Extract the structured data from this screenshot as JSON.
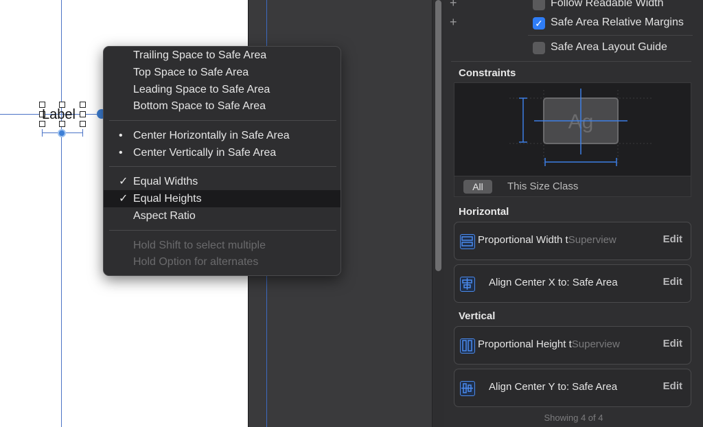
{
  "canvas": {
    "label": "Label"
  },
  "menu": {
    "items": [
      {
        "label": "Trailing Space to Safe Area",
        "mark": ""
      },
      {
        "label": "Top Space to Safe Area",
        "mark": ""
      },
      {
        "label": "Leading Space to Safe Area",
        "mark": ""
      },
      {
        "label": "Bottom Space to Safe Area",
        "mark": ""
      },
      {
        "label": "Center Horizontally in Safe Area",
        "mark": "•"
      },
      {
        "label": "Center Vertically in Safe Area",
        "mark": "•"
      },
      {
        "label": "Equal Widths",
        "mark": "✓"
      },
      {
        "label": "Equal Heights",
        "mark": "✓"
      },
      {
        "label": "Aspect Ratio",
        "mark": ""
      },
      {
        "label": "Hold Shift to select multiple",
        "mark": ""
      },
      {
        "label": "Hold Option for alternates",
        "mark": ""
      }
    ]
  },
  "inspector": {
    "options": [
      {
        "label": "Follow Readable Width",
        "checked": false
      },
      {
        "label": "Safe Area Relative Margins",
        "checked": true
      },
      {
        "label": "Safe Area Layout Guide",
        "checked": false
      }
    ],
    "constraints_title": "Constraints",
    "preview_text": "Ag",
    "size_tabs": {
      "all": "All",
      "this_size": "This Size Class"
    },
    "horizontal_title": "Horizontal",
    "vertical_title": "Vertical",
    "horizontal": [
      {
        "text": "Proportional Width t",
        "sub": "Superview",
        "edit": "Edit"
      },
      {
        "text": "Align Center X to:  Safe Area",
        "sub": "",
        "edit": "Edit"
      }
    ],
    "vertical": [
      {
        "text": "Proportional Height t",
        "sub": "Superview",
        "edit": "Edit"
      },
      {
        "text": "Align Center Y to:  Safe Area",
        "sub": "",
        "edit": "Edit"
      }
    ],
    "footer": "Showing 4 of 4"
  }
}
